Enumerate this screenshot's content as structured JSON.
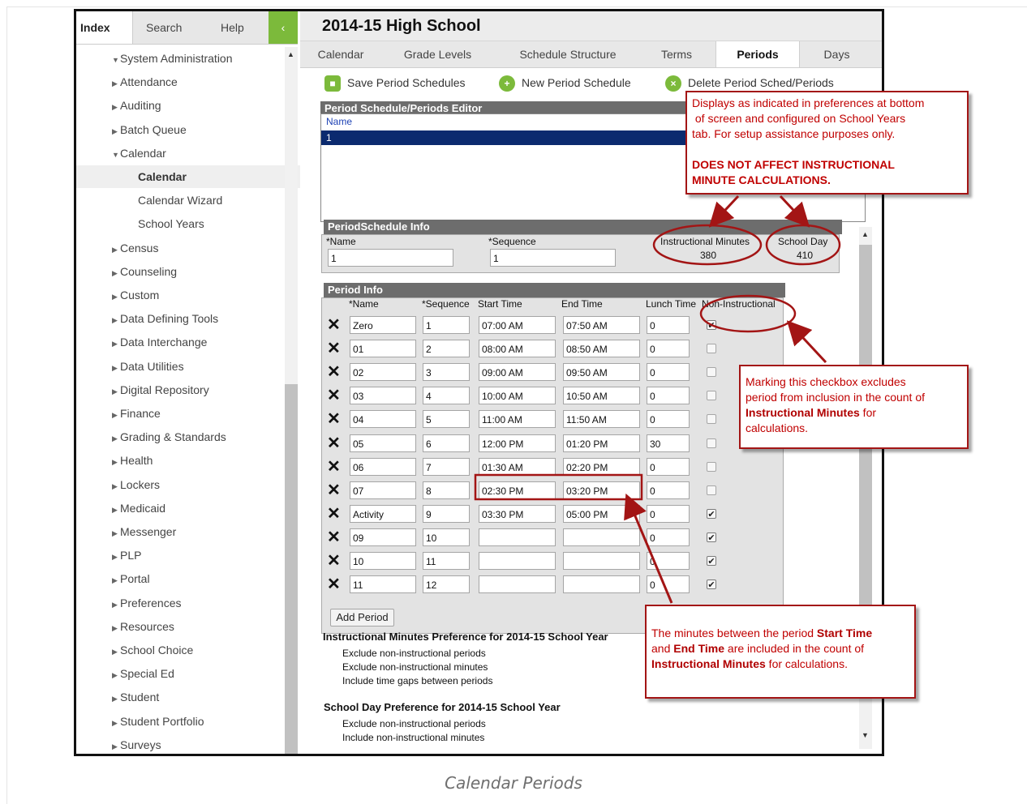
{
  "nav": {
    "tabs": [
      "Index",
      "Search",
      "Help"
    ],
    "collapse_icon": "chevron-left-icon",
    "tree": [
      {
        "label": "System Administration",
        "expanded": true
      },
      {
        "label": "Attendance"
      },
      {
        "label": "Auditing"
      },
      {
        "label": "Batch Queue"
      },
      {
        "label": "Calendar",
        "expanded": true
      },
      {
        "label": "Calendar",
        "active": true
      },
      {
        "label": "Calendar Wizard"
      },
      {
        "label": "School Years"
      },
      {
        "label": "Census"
      },
      {
        "label": "Counseling"
      },
      {
        "label": "Custom"
      },
      {
        "label": "Data Defining Tools"
      },
      {
        "label": "Data Interchange"
      },
      {
        "label": "Data Utilities"
      },
      {
        "label": "Digital Repository"
      },
      {
        "label": "Finance"
      },
      {
        "label": "Grading & Standards"
      },
      {
        "label": "Health"
      },
      {
        "label": "Lockers"
      },
      {
        "label": "Medicaid"
      },
      {
        "label": "Messenger"
      },
      {
        "label": "PLP"
      },
      {
        "label": "Portal"
      },
      {
        "label": "Preferences"
      },
      {
        "label": "Resources"
      },
      {
        "label": "School Choice"
      },
      {
        "label": "Special Ed"
      },
      {
        "label": "Student"
      },
      {
        "label": "Student Portfolio"
      },
      {
        "label": "Surveys"
      }
    ]
  },
  "header": {
    "title": "2014-15 High School"
  },
  "tabs": [
    "Calendar",
    "Grade Levels",
    "Schedule Structure",
    "Terms",
    "Periods",
    "Days"
  ],
  "active_tab": "Periods",
  "toolbar": {
    "save": "Save Period Schedules",
    "new": "New Period Schedule",
    "delete": "Delete Period Sched/Periods"
  },
  "editor": {
    "title": "Period Schedule/Periods Editor",
    "column": "Name",
    "selected": "1"
  },
  "schedule_info": {
    "title": "PeriodSchedule Info",
    "name_label": "*Name",
    "name_value": "1",
    "sequence_label": "*Sequence",
    "sequence_value": "1",
    "instr_label": "Instructional Minutes",
    "instr_value": "380",
    "day_label": "School Day",
    "day_value": "410"
  },
  "period_info": {
    "title": "Period Info",
    "columns": [
      "*Name",
      "*Sequence",
      "Start Time",
      "End Time",
      "Lunch Time",
      "Non-Instructional"
    ],
    "rows": [
      {
        "name": "Zero",
        "seq": "1",
        "start": "07:00 AM",
        "end": "07:50 AM",
        "lunch": "0",
        "non": true
      },
      {
        "name": "01",
        "seq": "2",
        "start": "08:00 AM",
        "end": "08:50 AM",
        "lunch": "0",
        "non": false
      },
      {
        "name": "02",
        "seq": "3",
        "start": "09:00 AM",
        "end": "09:50 AM",
        "lunch": "0",
        "non": false
      },
      {
        "name": "03",
        "seq": "4",
        "start": "10:00 AM",
        "end": "10:50 AM",
        "lunch": "0",
        "non": false
      },
      {
        "name": "04",
        "seq": "5",
        "start": "11:00 AM",
        "end": "11:50 AM",
        "lunch": "0",
        "non": false
      },
      {
        "name": "05",
        "seq": "6",
        "start": "12:00 PM",
        "end": "01:20 PM",
        "lunch": "30",
        "non": false
      },
      {
        "name": "06",
        "seq": "7",
        "start": "01:30 AM",
        "end": "02:20 PM",
        "lunch": "0",
        "non": false
      },
      {
        "name": "07",
        "seq": "8",
        "start": "02:30 PM",
        "end": "03:20 PM",
        "lunch": "0",
        "non": false
      },
      {
        "name": "Activity",
        "seq": "9",
        "start": "03:30 PM",
        "end": "05:00 PM",
        "lunch": "0",
        "non": true
      },
      {
        "name": "09",
        "seq": "10",
        "start": "",
        "end": "",
        "lunch": "0",
        "non": true
      },
      {
        "name": "10",
        "seq": "11",
        "start": "",
        "end": "",
        "lunch": "0",
        "non": true
      },
      {
        "name": "11",
        "seq": "12",
        "start": "",
        "end": "",
        "lunch": "0",
        "non": true
      }
    ],
    "add_button": "Add Period"
  },
  "preferences": {
    "instr_title": "Instructional Minutes Preference for 2014-15 School Year",
    "instr_items": [
      "Exclude non-instructional periods",
      "Exclude non-instructional minutes",
      "Include time gaps between periods"
    ],
    "day_title": "School Day Preference for 2014-15 School Year",
    "day_items": [
      "Exclude non-instructional periods",
      "Include non-instructional minutes"
    ]
  },
  "callouts": {
    "top_line1": "Displays as indicated in preferences at bottom",
    "top_line2": " of screen and configured on School Years",
    "top_line3": "tab. For setup assistance purposes only.",
    "top_bold1": "DOES NOT AFFECT INSTRUCTIONAL",
    "top_bold2": "MINUTE CALCULATIONS.",
    "mid_line1": "Marking this checkbox excludes",
    "mid_line2": "period from inclusion in the count of",
    "mid_bold": "Instructional Minutes",
    "mid_after": " for",
    "mid_line4": "calculations.",
    "bot_line1a": "The minutes between the period ",
    "bot_bold1": "Start Time",
    "bot_line2a": "and ",
    "bot_bold2": "End Time",
    "bot_line2b": " are included in the count of",
    "bot_bold3": "Instructional Minutes",
    "bot_line3b": " for calculations."
  },
  "caption": "Calendar Periods",
  "colors": {
    "accent_green": "#7cba3b",
    "callout_red": "#c00000",
    "selected_blue": "#0b2a6f",
    "header_gray": "#6d6d6d"
  }
}
